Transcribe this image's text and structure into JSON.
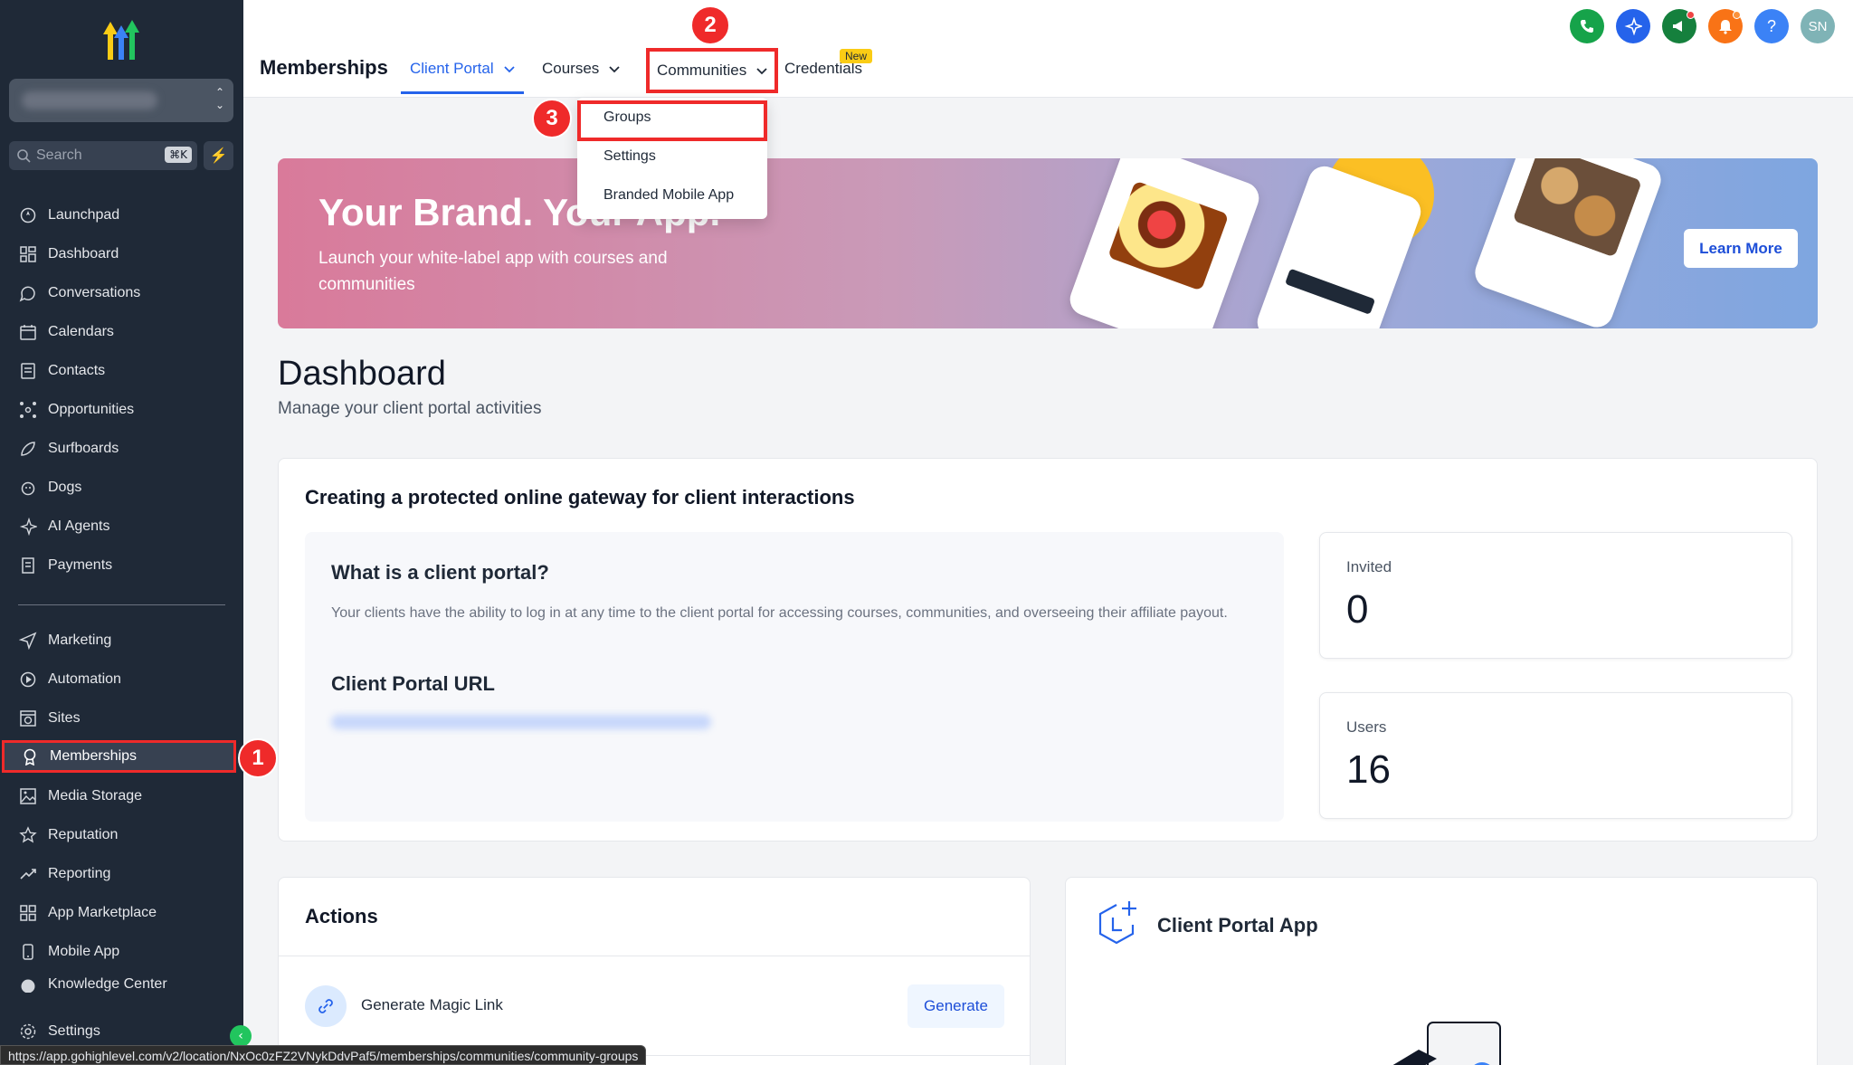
{
  "sidebar": {
    "account_name": "",
    "search": {
      "placeholder": "Search",
      "shortcut": "⌘K"
    },
    "items": [
      {
        "label": "Launchpad",
        "icon": "rocket-icon"
      },
      {
        "label": "Dashboard",
        "icon": "grid-icon"
      },
      {
        "label": "Conversations",
        "icon": "chat-icon"
      },
      {
        "label": "Calendars",
        "icon": "calendar-icon"
      },
      {
        "label": "Contacts",
        "icon": "contact-card-icon"
      },
      {
        "label": "Opportunities",
        "icon": "network-icon"
      },
      {
        "label": "Surfboards",
        "icon": "surfboard-icon"
      },
      {
        "label": "Dogs",
        "icon": "paw-icon"
      },
      {
        "label": "AI Agents",
        "icon": "sparkle-icon"
      },
      {
        "label": "Payments",
        "icon": "receipt-icon"
      },
      {
        "label": "Marketing",
        "icon": "send-icon"
      },
      {
        "label": "Automation",
        "icon": "automation-icon"
      },
      {
        "label": "Sites",
        "icon": "globe-window-icon"
      },
      {
        "label": "Memberships",
        "icon": "award-icon",
        "active": true
      },
      {
        "label": "Media Storage",
        "icon": "image-icon"
      },
      {
        "label": "Reputation",
        "icon": "star-icon"
      },
      {
        "label": "Reporting",
        "icon": "trend-icon"
      },
      {
        "label": "App Marketplace",
        "icon": "apps-icon"
      },
      {
        "label": "Mobile App",
        "icon": "mobile-icon"
      },
      {
        "label": "Knowledge Center",
        "icon": "book-icon"
      },
      {
        "label": "Settings",
        "icon": "gear-icon"
      }
    ]
  },
  "header": {
    "title": "Memberships",
    "tabs": {
      "client_portal": "Client Portal",
      "courses": "Courses",
      "communities": "Communities",
      "credentials": "Credentials",
      "new_badge": "New"
    },
    "avatar_initials": "SN",
    "help": "?"
  },
  "dropdown": {
    "items": [
      "Groups",
      "Settings",
      "Branded Mobile App"
    ]
  },
  "steps": [
    "1",
    "2",
    "3"
  ],
  "banner": {
    "title": "Your Brand. Your App.",
    "subtitle": "Launch your white-label app with courses and communities",
    "button": "Learn More"
  },
  "dashboard": {
    "title": "Dashboard",
    "subtitle": "Manage your client portal activities",
    "card_title": "Creating a protected online gateway for client interactions",
    "what_title": "What is a client portal?",
    "what_desc": "Your clients have the ability to log in at any time to the client portal for accessing courses, communities, and overseeing their affiliate payout.",
    "url_title": "Client Portal URL",
    "stats": [
      {
        "label": "Invited",
        "value": "0"
      },
      {
        "label": "Users",
        "value": "16"
      }
    ]
  },
  "actions": {
    "title": "Actions",
    "rows": [
      {
        "label": "Generate Magic Link",
        "button": "Generate"
      }
    ]
  },
  "app_card": {
    "title": "Client Portal App"
  },
  "status_url": "https://app.gohighlevel.com/v2/location/NxOc0zFZ2VNykDdvPaf5/memberships/communities/community-groups",
  "colors": {
    "sidebar_bg": "#1f2937",
    "accent": "#2563eb",
    "highlight": "#ef2a2a"
  }
}
